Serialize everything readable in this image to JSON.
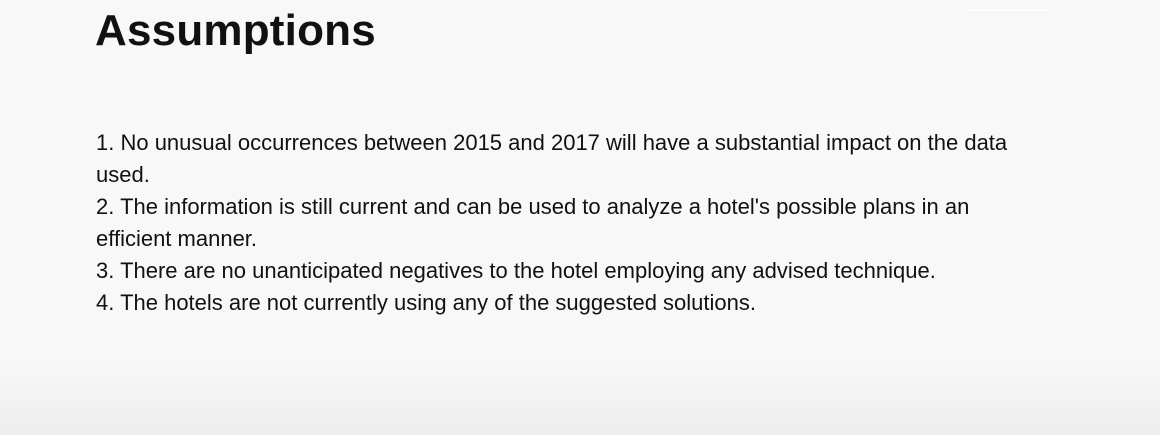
{
  "slide": {
    "title": "Assumptions",
    "items": [
      "1. No unusual occurrences between 2015 and 2017 will have a substantial impact on the data used.",
      "2. The information is still current and can be used to analyze a hotel's possible plans in an efficient manner.",
      "3. There are no unanticipated negatives to the hotel employing any advised technique.",
      "4. The hotels are not currently using any of the suggested solutions."
    ]
  }
}
